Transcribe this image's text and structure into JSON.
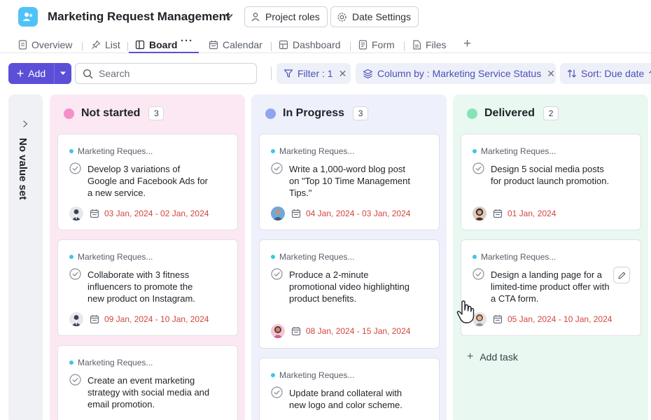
{
  "header": {
    "title": "Marketing Request Management",
    "project_roles": "Project roles",
    "date_settings": "Date Settings",
    "colors": {
      "accent": "#5b4fd8",
      "app_icon": "#4fc3f7"
    }
  },
  "tabs": [
    {
      "label": "Overview",
      "icon": "document-icon"
    },
    {
      "label": "List",
      "icon": "pin-icon"
    },
    {
      "label": "Board",
      "icon": "board-icon",
      "active": true
    },
    {
      "label": "Calendar",
      "icon": "calendar-icon"
    },
    {
      "label": "Dashboard",
      "icon": "dashboard-icon"
    },
    {
      "label": "Form",
      "icon": "form-icon"
    },
    {
      "label": "Files",
      "icon": "file-icon"
    }
  ],
  "toolbar": {
    "add_label": "Add",
    "search_placeholder": "Search",
    "filter_label": "Filter : 1",
    "column_by_label": "Column by : Marketing Service Status",
    "sort_label": "Sort: Due date"
  },
  "board": {
    "no_value_label": "No value set",
    "columns": [
      {
        "title": "Not started",
        "count": "3",
        "color": "#f48fc8",
        "cards": [
          {
            "project": "Marketing Reques...",
            "title": "Develop 3 variations of Google and Facebook Ads for a new service.",
            "date": "03 Jan, 2024 - 02 Jan, 2024"
          },
          {
            "project": "Marketing Reques...",
            "title": "Collaborate with 3 fitness influencers to promote the new product on Instagram.",
            "date": "09 Jan, 2024 - 10 Jan, 2024"
          },
          {
            "project": "Marketing Reques...",
            "title": "Create an event marketing strategy with social media and email promotion."
          }
        ]
      },
      {
        "title": "In Progress",
        "count": "3",
        "color": "#8ea5ef",
        "cards": [
          {
            "project": "Marketing Reques...",
            "title": "Write a 1,000-word blog post on \"Top 10 Time Management Tips.\"",
            "date": "04 Jan, 2024 - 03 Jan, 2024"
          },
          {
            "project": "Marketing Reques...",
            "title": "Produce a 2-minute promotional video highlighting product benefits.",
            "date": "08 Jan, 2024 - 15 Jan, 2024"
          },
          {
            "project": "Marketing Reques...",
            "title": "Update brand collateral with new logo and color scheme."
          }
        ]
      },
      {
        "title": "Delivered",
        "count": "2",
        "color": "#86e3b6",
        "cards": [
          {
            "project": "Marketing Reques...",
            "title": "Design 5 social media posts for product launch promotion.",
            "date": "01 Jan, 2024"
          },
          {
            "project": "Marketing Reques...",
            "title": "Design a landing page for a limited-time product offer with a CTA form.",
            "date": "05 Jan, 2024 - 10 Jan, 2024"
          }
        ],
        "add_task_label": "Add task"
      }
    ]
  }
}
